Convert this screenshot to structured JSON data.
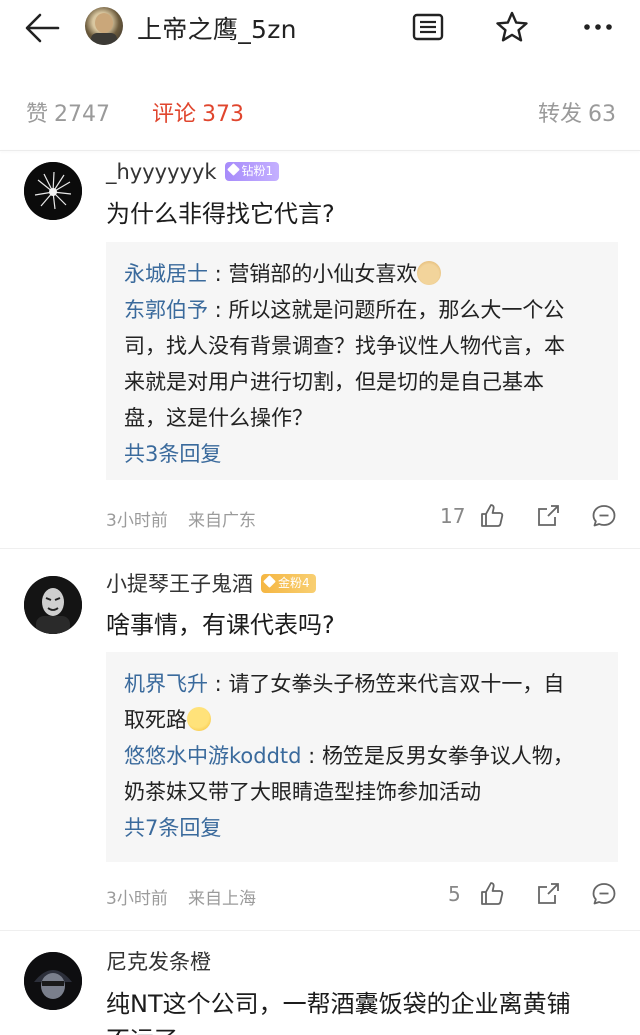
{
  "header": {
    "title": "上帝之鹰_5zn"
  },
  "tabs": {
    "like_label": "赞",
    "like_count": "2747",
    "comment_label": "评论",
    "comment_count": "373",
    "repost_label": "转发",
    "repost_count": "63"
  },
  "comments": [
    {
      "username": "_hyyyyyyk",
      "badge": "钻粉1",
      "text": "为什么非得找它代言?",
      "replies": [
        {
          "name": "永城居士",
          "text": "营销部的小仙女喜欢"
        },
        {
          "name": "东郭伯予",
          "lines": [
            "所以这就是问题所在，那么大一个公",
            "司，找人没有背景调查？找争议性人物代言，本",
            "来就是对用户进行切割，但是切的是自己基本",
            "盘，这是什么操作？"
          ]
        }
      ],
      "more": "共3条回复",
      "time": "3小时前",
      "location": "来自广东",
      "likes": "17"
    },
    {
      "username": "小提琴王子鬼酒",
      "badge": "金粉4",
      "text": "啥事情，有课代表吗?",
      "replies": [
        {
          "name": "机界飞升",
          "lines": [
            "请了女拳头子杨笠来代言双十一，自",
            "取死路"
          ]
        },
        {
          "name": "悠悠水中游koddtd",
          "lines": [
            "杨笠是反男女拳争议人物，",
            "奶茶妹又带了大眼睛造型挂饰参加活动"
          ]
        }
      ],
      "more": "共7条回复",
      "time": "3小时前",
      "location": "来自上海",
      "likes": "5"
    },
    {
      "username": "尼克发条橙",
      "text": "纯NT这个公司，一帮酒囊饭袋的企业离黄铺",
      "text_cut": "不远了"
    }
  ],
  "icons": [
    "back-arrow-icon",
    "list-icon",
    "star-icon",
    "more-icon",
    "thumb-up-icon",
    "share-icon",
    "comment-icon"
  ],
  "colors": {
    "accent": "#e0462e",
    "link": "#3a6a9c",
    "muted": "#9b9b9b"
  }
}
